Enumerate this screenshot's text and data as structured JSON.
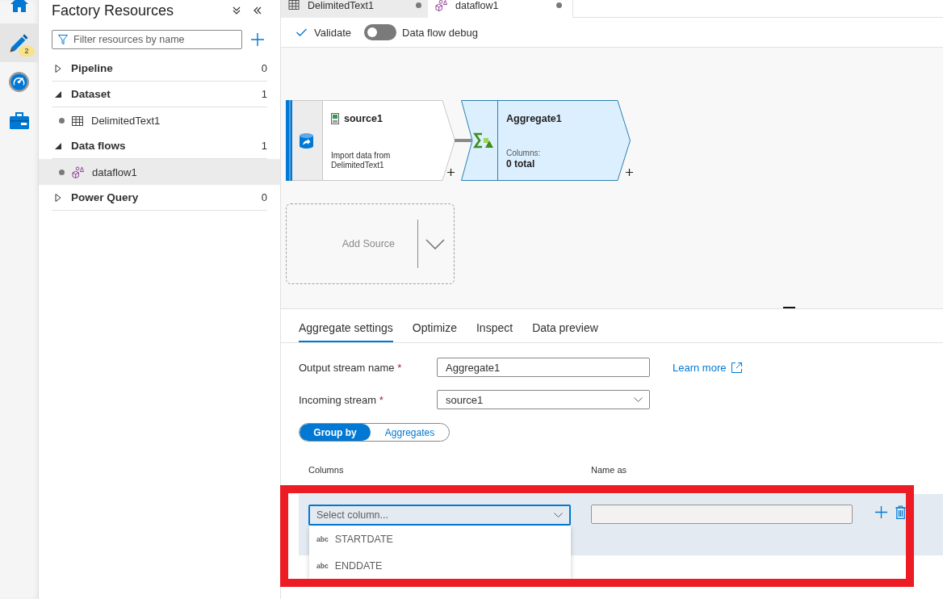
{
  "rail": {
    "items": [
      {
        "kind": "home",
        "selected": false
      },
      {
        "kind": "author",
        "selected": true,
        "badge": "2"
      },
      {
        "kind": "monitor",
        "selected": false
      },
      {
        "kind": "manage",
        "selected": false
      }
    ]
  },
  "sidebar": {
    "title": "Factory Resources",
    "filter": {
      "placeholder": "Filter resources by name"
    },
    "sections": [
      {
        "label": "Pipeline",
        "count": "0",
        "expanded": false
      },
      {
        "label": "Dataset",
        "count": "1",
        "expanded": true,
        "children": [
          {
            "kind": "dataset",
            "label": "DelimitedText1",
            "selected": false,
            "unsaved": true
          }
        ]
      },
      {
        "label": "Data flows",
        "count": "1",
        "expanded": true,
        "children": [
          {
            "kind": "dataflow",
            "label": "dataflow1",
            "selected": true,
            "unsaved": true
          }
        ]
      },
      {
        "label": "Power Query",
        "count": "0",
        "expanded": false
      }
    ]
  },
  "tabs": [
    {
      "kind": "dataset",
      "label": "DelimitedText1",
      "selected": false,
      "unsaved": true
    },
    {
      "kind": "dataflow",
      "label": "dataflow1",
      "selected": true,
      "unsaved": true
    }
  ],
  "toolbar": {
    "validate": "Validate",
    "debug": {
      "label": "Data flow debug",
      "on": false
    }
  },
  "canvas": {
    "nodes": [
      {
        "kind": "source",
        "title": "source1",
        "description": "Import data from DelimitedText1",
        "selected": false
      },
      {
        "kind": "aggregate",
        "title": "Aggregate1",
        "caption": "Columns:",
        "summary": "0 total",
        "selected": true
      }
    ],
    "add_source": "Add Source"
  },
  "panel": {
    "tabs": [
      {
        "label": "Aggregate settings",
        "selected": true
      },
      {
        "label": "Optimize",
        "selected": false
      },
      {
        "label": "Inspect",
        "selected": false
      },
      {
        "label": "Data preview",
        "selected": false
      }
    ],
    "fields": [
      {
        "kind": "text",
        "label": "Output stream name",
        "marker": "*",
        "value": "Aggregate1",
        "link": "Learn more"
      },
      {
        "kind": "select",
        "label": "Incoming stream",
        "marker": "*",
        "value": "source1"
      }
    ],
    "modes": [
      {
        "label": "Group by",
        "selected": true
      },
      {
        "label": "Aggregates",
        "selected": false
      }
    ],
    "group_by": {
      "columns": [
        "Columns",
        "Name as"
      ],
      "rows": [
        {
          "column": {
            "placeholder": "Select column...",
            "expanded": true,
            "options": [
              {
                "type": "abc",
                "label": "STARTDATE"
              },
              {
                "type": "abc",
                "label": "ENDDATE"
              }
            ]
          },
          "name_as": {
            "disabled": true
          }
        }
      ]
    }
  },
  "annotation": {
    "kind": "rectangle"
  }
}
